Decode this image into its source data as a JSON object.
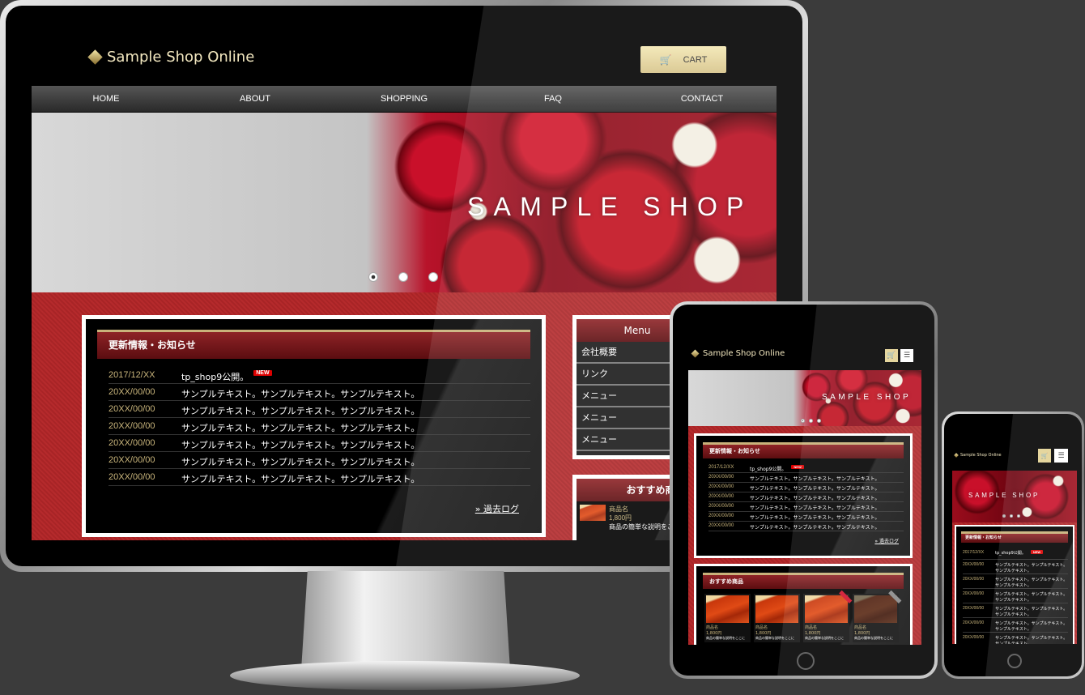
{
  "site": {
    "logo": "Sample Shop Online",
    "cart_label": "CART",
    "nav": [
      "HOME",
      "ABOUT",
      "SHOPPING",
      "FAQ",
      "CONTACT"
    ],
    "hero_title": "SAMPLE SHOP",
    "slider_dots": 3,
    "slider_active": 1,
    "news": {
      "title": "更新情報・お知らせ",
      "new_badge": "NEW",
      "more": "過去ログ",
      "items": [
        {
          "date": "2017/12/XX",
          "text": "tp_shop9公開。"
        },
        {
          "date": "20XX/00/00",
          "text": "サンプルテキスト。サンプルテキスト。サンプルテキスト。"
        },
        {
          "date": "20XX/00/00",
          "text": "サンプルテキスト。サンプルテキスト。サンプルテキスト。"
        },
        {
          "date": "20XX/00/00",
          "text": "サンプルテキスト。サンプルテキスト。サンプルテキスト。"
        },
        {
          "date": "20XX/00/00",
          "text": "サンプルテキスト。サンプルテキスト。サンプルテキスト。"
        },
        {
          "date": "20XX/00/00",
          "text": "サンプルテキスト。サンプルテキスト。サンプルテキスト。"
        },
        {
          "date": "20XX/00/00",
          "text": "サンプルテキスト。サンプルテキスト。サンプルテキスト。"
        }
      ]
    },
    "menu": {
      "title": "Menu",
      "items": [
        "会社概要",
        "リンク",
        "メニュー",
        "メニュー",
        "メニュー"
      ]
    },
    "recommended": {
      "title": "おすすめ商品",
      "products": [
        {
          "name": "商品名",
          "price": "1,800円",
          "desc": "商品の簡単な説明をここに"
        },
        {
          "name": "商品名",
          "price": "1,800円",
          "desc": "商品の簡単な説明をここに"
        },
        {
          "name": "商品名",
          "price": "1,800円",
          "desc": "商品の簡単な説明をここに",
          "ribbon": "red"
        },
        {
          "name": "商品名",
          "price": "1,800円",
          "desc": "商品の簡単な説明をここに",
          "ribbon": "gray"
        }
      ]
    }
  },
  "colors": {
    "background": "#3b3b3b",
    "accent_gold": "#c9b57c",
    "header_red": "#8e2326",
    "content_red": "#b52a2c",
    "new_badge": "#dd0000"
  }
}
